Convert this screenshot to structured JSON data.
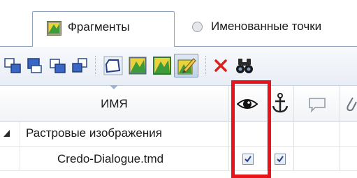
{
  "tabs": [
    {
      "label": "Фрагменты",
      "active": true,
      "icon": "fragment-icon"
    },
    {
      "label": "Именованные точки",
      "active": false,
      "icon": "radio-icon"
    }
  ],
  "toolbar": {
    "buttons": [
      "align-bring-front-icon",
      "align-send-back-icon",
      "align-forward-icon",
      "align-backward-icon",
      "polygon-icon",
      "fragment-image-icon",
      "fragment-image-green-icon",
      "fragment-edit-pressed-icon",
      "delete-x-icon",
      "binoculars-icon"
    ]
  },
  "grid": {
    "columns": {
      "name": "ИМЯ",
      "visibility": "eye-icon",
      "anchor": "anchor-icon",
      "comment": "comment-icon",
      "attach": "paperclip-icon"
    },
    "group": {
      "label": "Растровые изображения",
      "expanded": true
    },
    "rows": [
      {
        "label": "Credo-Dialogue.tmd",
        "visible": true,
        "anchored": true
      }
    ]
  },
  "colors": {
    "highlight": "#e8141b",
    "tab_border": "#8da3bf"
  }
}
